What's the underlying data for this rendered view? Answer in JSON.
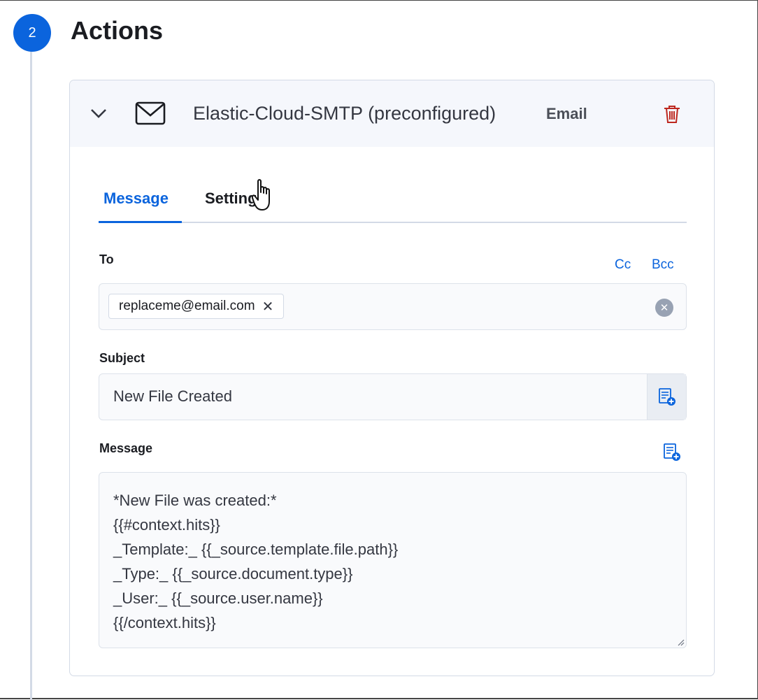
{
  "step": {
    "number": "2",
    "title": "Actions"
  },
  "action": {
    "connector_name": "Elastic-Cloud-SMTP (preconfigured)",
    "connector_type": "Email",
    "icons": {
      "toggle": "chevron-down-icon",
      "connector": "mail-icon",
      "delete": "trash-icon"
    }
  },
  "tabs": [
    {
      "label": "Message",
      "active": true
    },
    {
      "label": "Settings",
      "active": false
    }
  ],
  "to": {
    "label": "To",
    "cc_label": "Cc",
    "bcc_label": "Bcc",
    "recipients": [
      "replaceme@email.com"
    ]
  },
  "subject": {
    "label": "Subject",
    "value": "New File Created"
  },
  "message": {
    "label": "Message",
    "lines": [
      "*New File was created:*",
      "{{#context.hits}}",
      "_Template:_ {{_source.template.file.path}}",
      "_Type:_ {{_source.document.type}}",
      "_User:_ {{_source.user.name}}",
      "{{/context.hits}}"
    ]
  },
  "colors": {
    "accent": "#0b64dd",
    "danger": "#bd271e"
  }
}
